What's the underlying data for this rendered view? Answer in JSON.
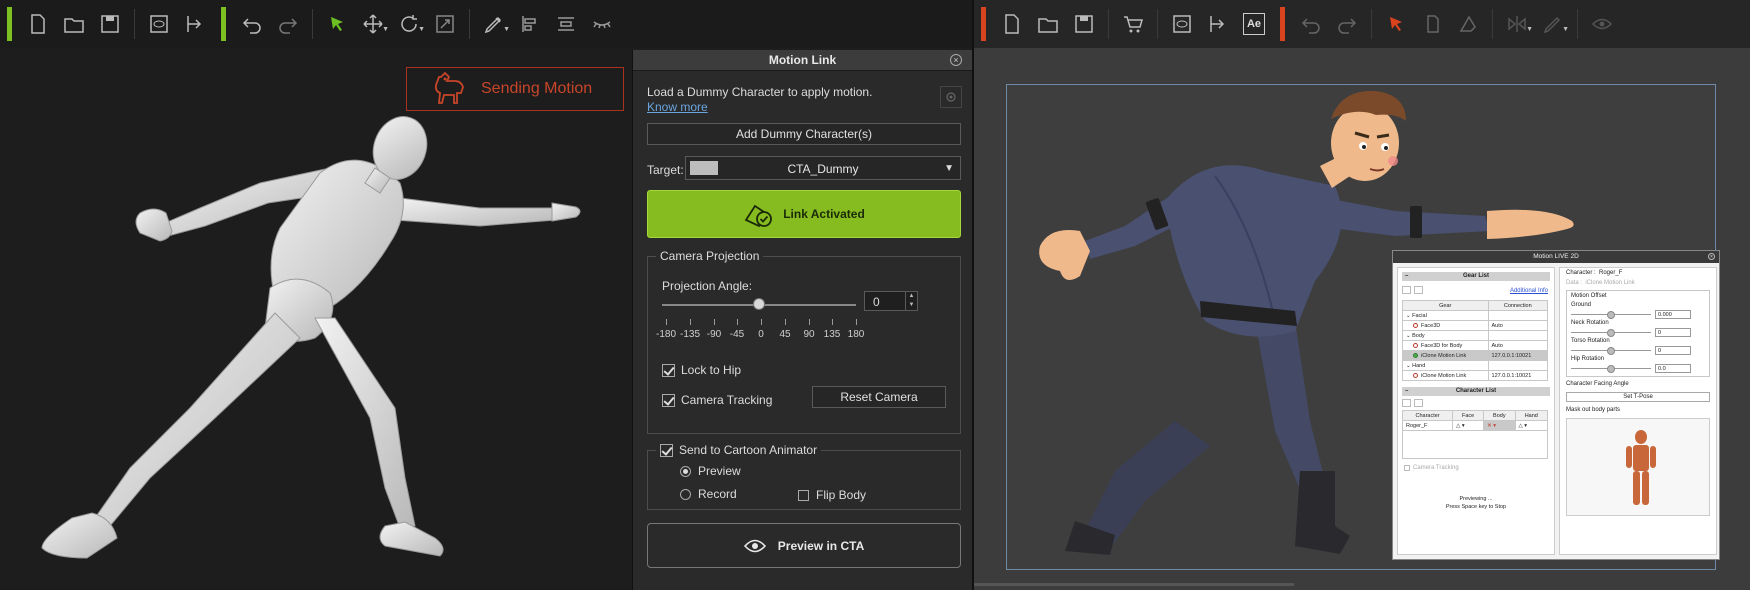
{
  "left_app": {
    "accent_color": "#7cc021",
    "toolbar_icons": [
      "new-file-icon",
      "open-folder-icon",
      "save-icon",
      "preview-icon",
      "export-icon",
      "undo-icon",
      "redo-icon",
      "select-arrow-icon",
      "move-icon",
      "rotate-icon",
      "scale-icon",
      "edit-motion-icon",
      "align-icon",
      "distribute-icon",
      "eyelash-icon"
    ],
    "sending_motion": "Sending Motion"
  },
  "motion_link": {
    "title": "Motion Link",
    "load_text": "Load a Dummy Character to apply motion.",
    "know_more": "Know more",
    "add_dummy": "Add Dummy Character(s)",
    "target_label": "Target:",
    "target_value": "CTA_Dummy",
    "link_button": "Link Activated",
    "link_color": "#86bc20",
    "camera_projection": {
      "legend": "Camera Projection",
      "angle_label": "Projection Angle:",
      "angle_value": "0",
      "slider_fraction": 0.5,
      "tick_labels": [
        "-180",
        "-135",
        "-90",
        "-45",
        "0",
        "45",
        "90",
        "135",
        "180"
      ],
      "lock_to_hip": "Lock to Hip",
      "lock_to_hip_checked": true,
      "camera_tracking": "Camera Tracking",
      "camera_tracking_checked": true,
      "reset_camera": "Reset Camera"
    },
    "send_to_cta": {
      "legend": "Send to Cartoon Animator",
      "checked": true,
      "preview": "Preview",
      "record": "Record",
      "selected": "Preview",
      "flip_body": "Flip Body",
      "flip_body_checked": false
    },
    "preview_button": "Preview in CTA"
  },
  "right_app": {
    "accent_color": "#d9431e",
    "toolbar_icons": [
      "new-file-icon",
      "open-folder-icon",
      "save-icon",
      "cart-icon",
      "preview-icon",
      "export-icon",
      "after-effects-icon",
      "undo-icon",
      "redo-icon",
      "select-arrow-icon",
      "copy-icon",
      "wardrobe-icon",
      "flip-icon",
      "edit-icon",
      "eye-icon"
    ],
    "ae_label": "Ae",
    "motion_live": {
      "title": "Motion LIVE 2D",
      "gear_list": "Gear List",
      "additional_info": "Additional Info",
      "gear_headers": [
        "Gear",
        "Connection"
      ],
      "gear_rows": [
        {
          "gear": "Facial",
          "connection": "",
          "type": "group"
        },
        {
          "gear": "Face3D",
          "connection": "Auto",
          "type": "item",
          "status": "off"
        },
        {
          "gear": "Body",
          "connection": "",
          "type": "group"
        },
        {
          "gear": "Face3D for Body",
          "connection": "Auto",
          "type": "item",
          "status": "off"
        },
        {
          "gear": "iClone Motion Link",
          "connection": "127.0.0.1:10021",
          "type": "item",
          "status": "on",
          "selected": true
        },
        {
          "gear": "Hand",
          "connection": "",
          "type": "group"
        },
        {
          "gear": "iClone Motion Link",
          "connection": "127.0.0.1:10021",
          "type": "item",
          "status": "off"
        }
      ],
      "character_list": "Character List",
      "char_headers": [
        "Character",
        "Face",
        "Body",
        "Hand"
      ],
      "char_row": "Roger_F",
      "camera_tracking": "Camera Tracking",
      "status_line1": "Previewing ...",
      "status_line2": "Press Space key to Stop",
      "character_label": "Character",
      "character_value": "Roger_F",
      "data_label": "Data",
      "data_value": "iClone Motion Link",
      "motion_offset": "Motion Offset",
      "ground": "Ground",
      "ground_value": "0.000",
      "neck_rotation": "Neck Rotation",
      "neck_value": "0",
      "torso_rotation": "Torso Rotation",
      "torso_value": "0",
      "hip_rotation": "Hip Rotation",
      "hip_value": "0.0",
      "facing_angle": "Character Facing Angle",
      "set_tpose": "Set T-Pose",
      "mask_out": "Mask out body parts"
    }
  }
}
